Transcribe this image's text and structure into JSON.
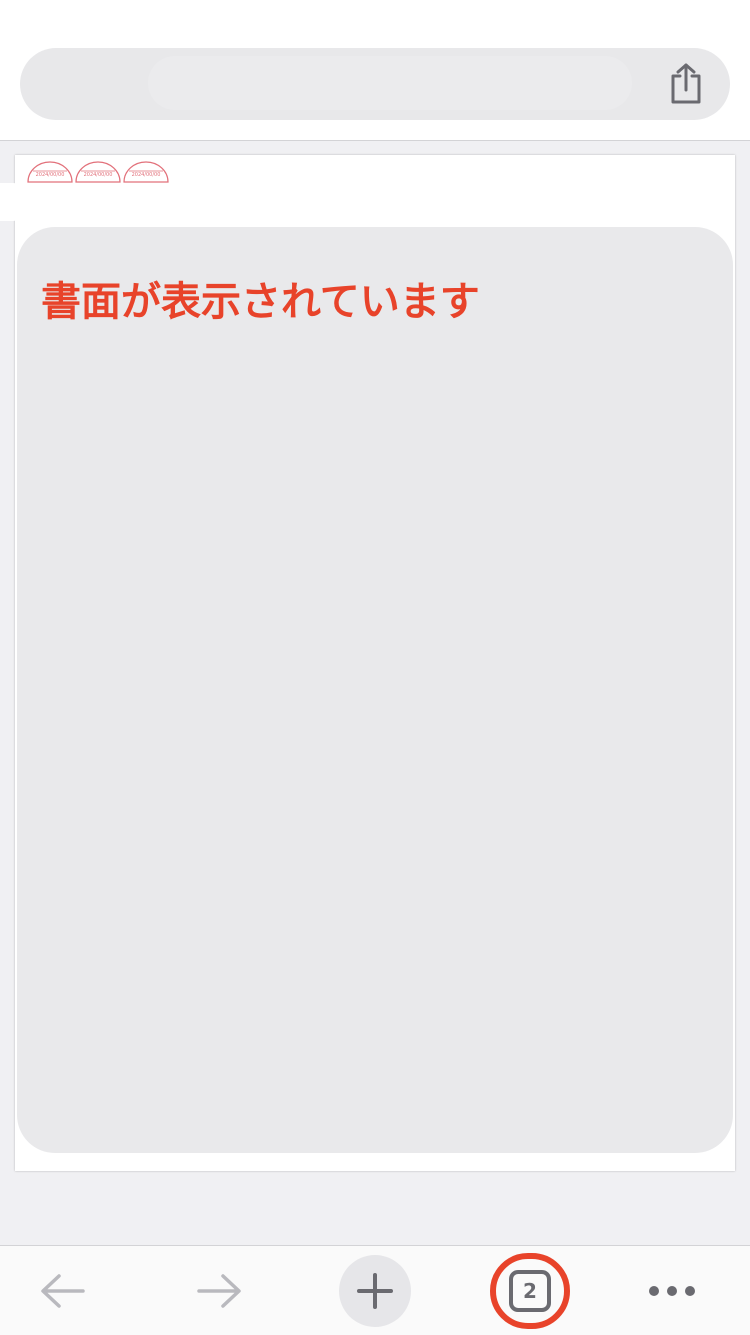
{
  "address_bar": {
    "url_text": "",
    "share_icon": "share-icon"
  },
  "document": {
    "stamps": [
      {
        "date": "2024/00/00"
      },
      {
        "date": "2024/00/00"
      },
      {
        "date": "2024/00/00"
      }
    ],
    "message": "書面が表示されています"
  },
  "toolbar": {
    "back_icon": "arrow-left-icon",
    "forward_icon": "arrow-right-icon",
    "new_tab_icon": "plus-icon",
    "tab_count": "2",
    "more_icon": "ellipsis-icon"
  },
  "colors": {
    "accent": "#e8432a",
    "stamp": "#e2707a",
    "panel": "#e9e9eb",
    "icon_disabled": "#b9b9be",
    "icon": "#6a6a70"
  }
}
